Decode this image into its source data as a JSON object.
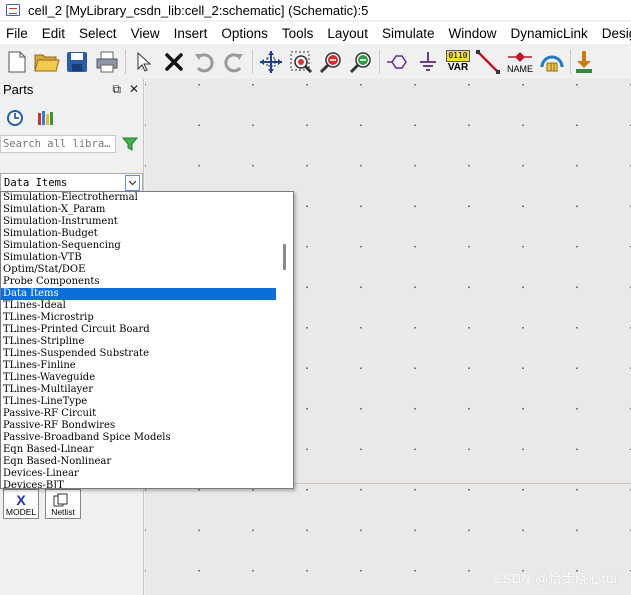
{
  "window": {
    "title": "cell_2 [MyLibrary_csdn_lib:cell_2:schematic] (Schematic):5"
  },
  "menubar": {
    "items": [
      "File",
      "Edit",
      "Select",
      "View",
      "Insert",
      "Options",
      "Tools",
      "Layout",
      "Simulate",
      "Window",
      "DynamicLink",
      "Desig"
    ]
  },
  "toolbar": {
    "var_label": "VAR",
    "var_bits": "0110",
    "name_label": "NAME"
  },
  "parts": {
    "title": "Parts",
    "search_placeholder": "Search all libra…",
    "selected_library": "Data Items",
    "palette": {
      "model_label": "MODEL",
      "model_glyph": "X",
      "netlist_label": "Netlist"
    }
  },
  "dropdown": {
    "items": [
      "Simulation-Electrothermal",
      "Simulation-X_Param",
      "Simulation-Instrument",
      "Simulation-Budget",
      "Simulation-Sequencing",
      "Simulation-VTB",
      "Optim/Stat/DOE",
      "Probe Components",
      "Data Items",
      "TLines-Ideal",
      "TLines-Microstrip",
      "TLines-Printed Circuit Board",
      "TLines-Stripline",
      "TLines-Suspended Substrate",
      "TLines-Finline",
      "TLines-Waveguide",
      "TLines-Multilayer",
      "TLines-LineType",
      "Passive-RF Circuit",
      "Passive-RF Bondwires",
      "Passive-Broadband Spice Models",
      "Eqn Based-Linear",
      "Eqn Based-Nonlinear",
      "Devices-Linear",
      "Devices-BJT"
    ],
    "selected_index": 8
  },
  "watermark": "CSDN @怡步晓心rui"
}
